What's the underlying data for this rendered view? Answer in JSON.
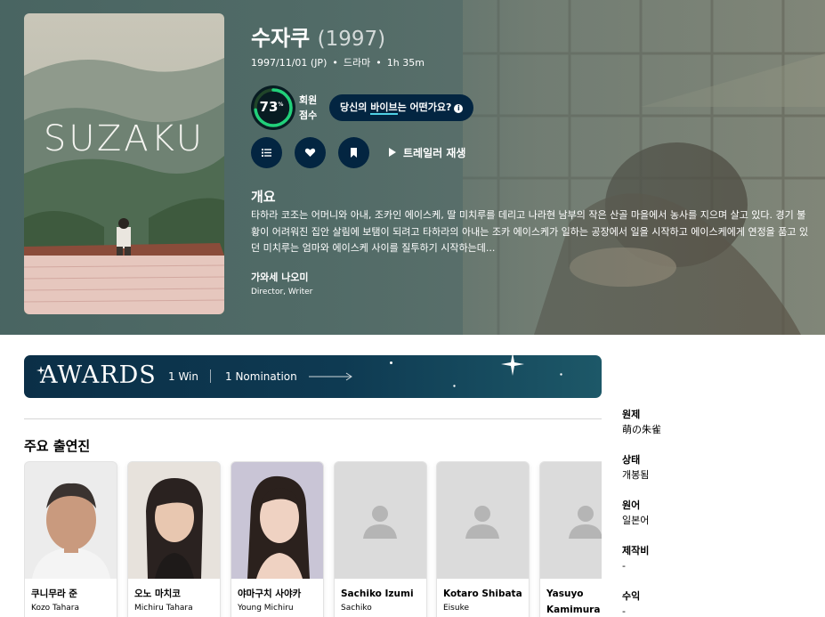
{
  "movie": {
    "title": "수자쿠",
    "year": "(1997)",
    "release": "1997/11/01 (JP)",
    "genre": "드라마",
    "runtime": "1h 35m",
    "poster_title": "SUZAKU"
  },
  "score": {
    "value": "73",
    "percent_sign": "%",
    "fraction": 0.73,
    "label": "회원 점수",
    "ring_color": "#21d07a",
    "track_color": "#204529"
  },
  "vibe": {
    "prefix": "당신의 ",
    "highlight": "바이브",
    "suffix": "는 어떤가요?",
    "info_icon": "i"
  },
  "actions": {
    "list_icon": "list-icon",
    "favorite_icon": "heart-icon",
    "watchlist_icon": "bookmark-icon",
    "trailer_label": "트레일러 재생"
  },
  "overview": {
    "heading": "개요",
    "text": "타하라 코조는 어머니와 아내, 조카인 에이스케, 딸 미치루를 데리고 나라현 남부의 작은 산골 마을에서 농사를 지으며 살고 있다. 경기 불황이 어려워진 집안 살림에 보탬이 되려고 타하라의 아내는 조카 에이스케가 일하는 공장에서 일을 시작하고 에이스케에게 연정을 품고 있던 미치루는 엄마와 에이스케 사이를 질투하기 시작하는데..."
  },
  "crew": {
    "name": "가와세 나오미",
    "role": "Director, Writer"
  },
  "awards": {
    "logo": "AWARDS",
    "wins": "1 Win",
    "nominations": "1 Nomination"
  },
  "cast": {
    "heading": "주요 출연진",
    "members": [
      {
        "name": "쿠니무라 준",
        "character": "Kozo Tahara",
        "photo": "person"
      },
      {
        "name": "오노 마치코",
        "character": "Michiru Tahara",
        "photo": "person"
      },
      {
        "name": "야마구치 사야카",
        "character": "Young Michiru",
        "photo": "person"
      },
      {
        "name": "Sachiko Izumi",
        "character": "Sachiko",
        "photo": "placeholder"
      },
      {
        "name": "Kotaro Shibata",
        "character": "Eisuke",
        "photo": "placeholder"
      },
      {
        "name": "Yasuyo Kamimura",
        "character": "",
        "photo": "placeholder"
      }
    ]
  },
  "sidebar": {
    "original_title_label": "원제",
    "original_title": "萌の朱雀",
    "status_label": "상태",
    "status": "개봉됨",
    "language_label": "원어",
    "language": "일본어",
    "budget_label": "제작비",
    "budget": "-",
    "revenue_label": "수익",
    "revenue": "-"
  },
  "colors": {
    "dark_navy": "#032541",
    "score_green": "#21d07a",
    "underline_cyan": "#4fd1e6"
  }
}
